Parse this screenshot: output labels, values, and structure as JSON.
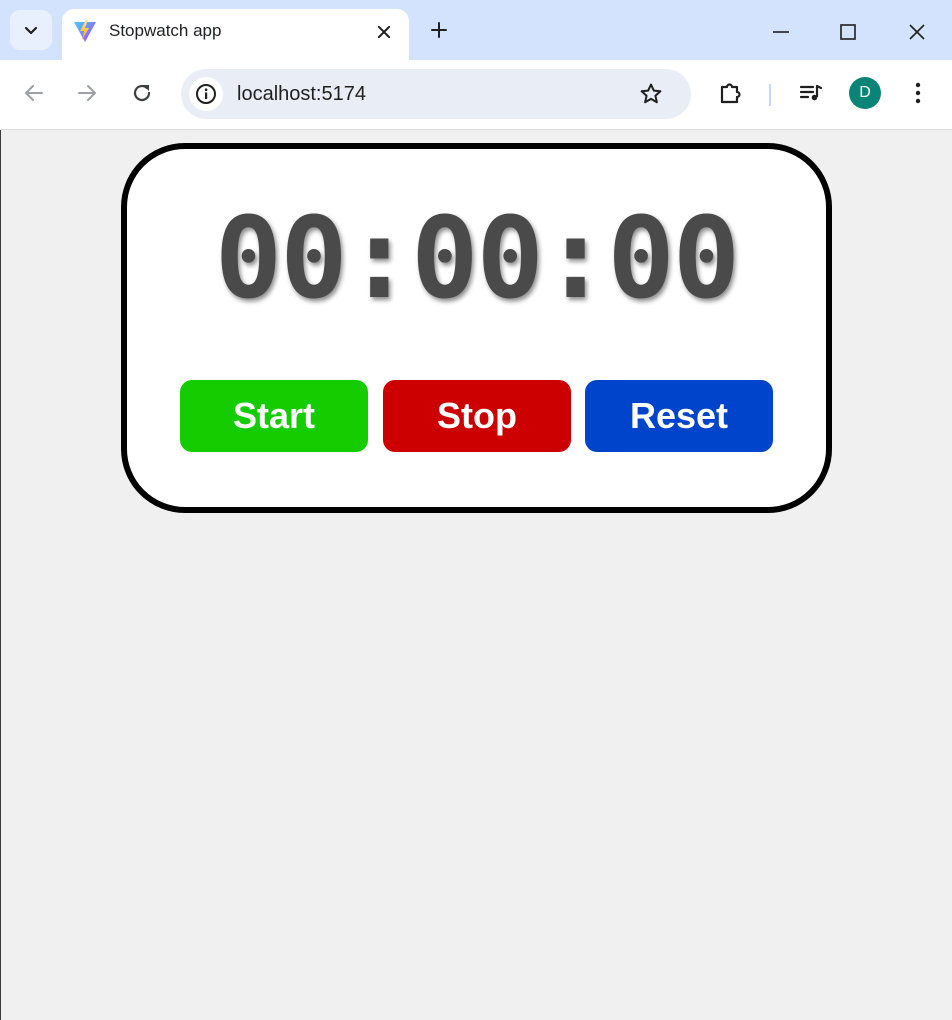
{
  "browser": {
    "tab_title": "Stopwatch app",
    "url": "localhost:5174",
    "profile_initial": "D"
  },
  "stopwatch": {
    "display": "00:00:00",
    "buttons": {
      "start": "Start",
      "stop": "Stop",
      "reset": "Reset"
    }
  },
  "colors": {
    "start": "#14cc00",
    "stop": "#cc0000",
    "reset": "#0044cc",
    "display_text": "#4a4a4a",
    "page_bg": "#f0f0f0",
    "chrome_bg": "#d3e3fd"
  },
  "icons": {
    "tab_search": "chevron-down-icon",
    "favicon": "vite-logo-icon",
    "tab_close": "close-icon",
    "new_tab": "plus-icon",
    "back": "arrow-left-icon",
    "forward": "arrow-right-icon",
    "reload": "reload-icon",
    "site_info": "info-icon",
    "bookmark": "star-icon",
    "extensions": "puzzle-icon",
    "media": "media-playlist-icon",
    "menu": "kebab-menu-icon"
  }
}
